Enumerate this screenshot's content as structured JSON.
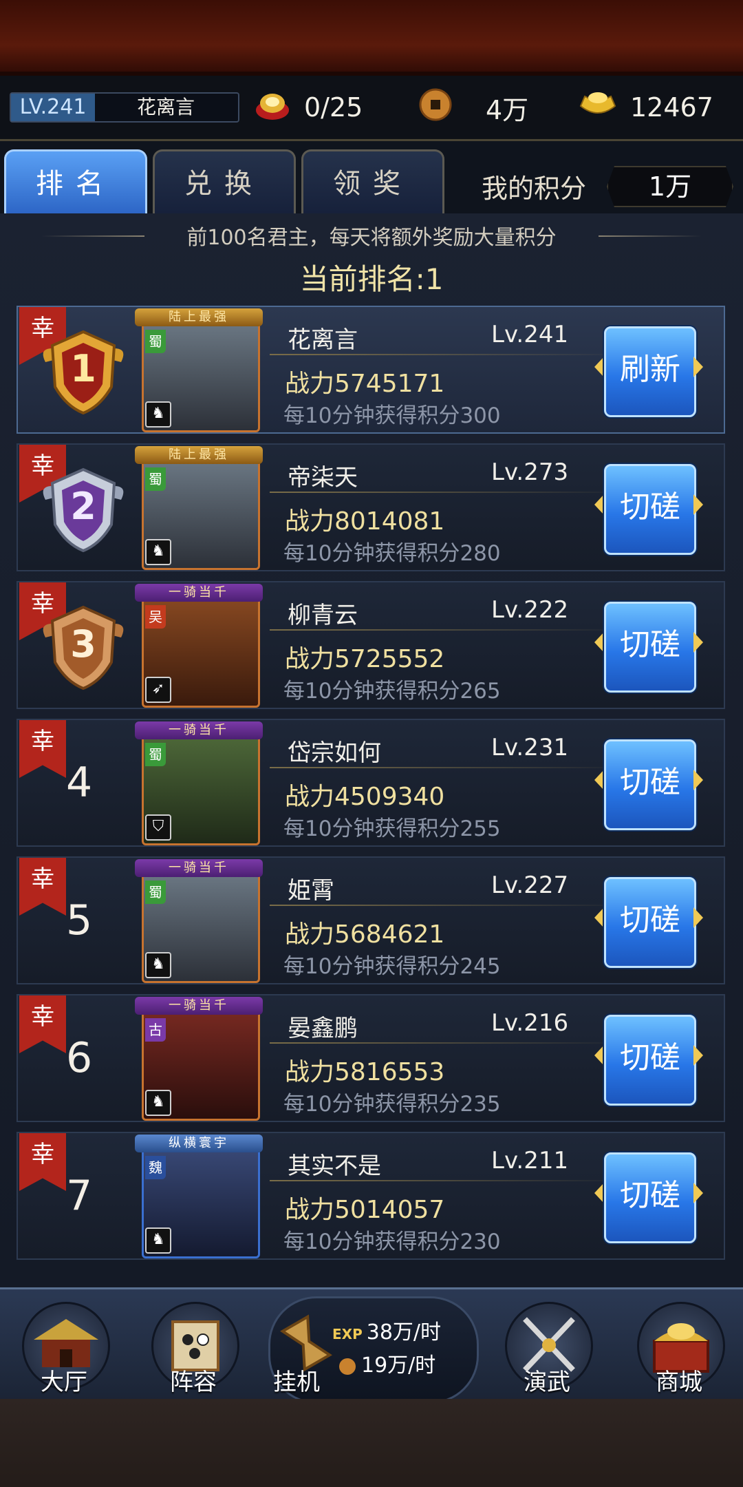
{
  "status": {
    "level": "LV.241",
    "player_name": "花离言",
    "stamina": "0/25",
    "coins": "4万",
    "gold": "12467"
  },
  "tabs": [
    {
      "label": "排名",
      "active": true
    },
    {
      "label": "兑换",
      "active": false
    },
    {
      "label": "领奖",
      "active": false
    }
  ],
  "my_score": {
    "label": "我的积分",
    "value": "1万"
  },
  "notice": "前100名君主，每天将额外奖励大量积分",
  "current_rank": "当前排名:1",
  "ribbon_text": "幸",
  "rows": [
    {
      "rank": "1",
      "banner": "陆上最强",
      "faction": "蜀",
      "name": "花离言",
      "level": "Lv.241",
      "power": "战力5745171",
      "rate": "每10分钟获得积分300",
      "button": "刷新"
    },
    {
      "rank": "2",
      "banner": "陆上最强",
      "faction": "蜀",
      "name": "帝柒天",
      "level": "Lv.273",
      "power": "战力8014081",
      "rate": "每10分钟获得积分280",
      "button": "切磋"
    },
    {
      "rank": "3",
      "banner": "一骑当千",
      "faction": "吴",
      "name": "柳青云",
      "level": "Lv.222",
      "power": "战力5725552",
      "rate": "每10分钟获得积分265",
      "button": "切磋"
    },
    {
      "rank": "4",
      "banner": "一骑当千",
      "faction": "蜀",
      "name": "岱宗如何",
      "level": "Lv.231",
      "power": "战力4509340",
      "rate": "每10分钟获得积分255",
      "button": "切磋"
    },
    {
      "rank": "5",
      "banner": "一骑当千",
      "faction": "蜀",
      "name": "姫霄",
      "level": "Lv.227",
      "power": "战力5684621",
      "rate": "每10分钟获得积分245",
      "button": "切磋"
    },
    {
      "rank": "6",
      "banner": "一骑当千",
      "faction": "古",
      "name": "晏鑫鹏",
      "level": "Lv.216",
      "power": "战力5816553",
      "rate": "每10分钟获得积分235",
      "button": "切磋"
    },
    {
      "rank": "7",
      "banner": "纵横寰宇",
      "faction": "魏",
      "name": "其实不是",
      "level": "Lv.211",
      "power": "战力5014057",
      "rate": "每10分钟获得积分230",
      "button": "切磋"
    }
  ],
  "nav": {
    "hall": "大厅",
    "lineup": "阵容",
    "idle": "挂机",
    "idle_exp_tag": "EXP",
    "idle_exp": "38万/时",
    "idle_coin": "19万/时",
    "martial": "演武",
    "shop": "商城"
  },
  "icons": [
    "stamina-bowl-icon",
    "copper-coin-icon",
    "gold-ingot-icon",
    "unit-type-icon",
    "hall-building-icon",
    "lineup-scroll-icon",
    "hourglass-icon",
    "crossed-swords-icon",
    "treasure-chest-icon"
  ],
  "colors": {
    "accent_blue": "#2877e8",
    "ribbon_red": "#b3251c",
    "power_gold": "#f0e0a0"
  }
}
